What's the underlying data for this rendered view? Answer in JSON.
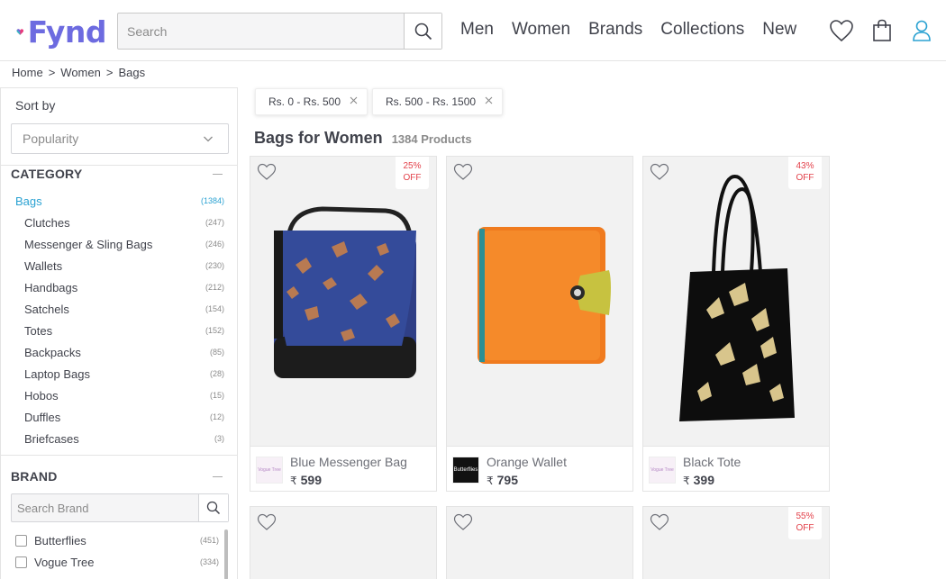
{
  "header": {
    "logo_text": "Fynd",
    "search_placeholder": "Search",
    "nav": [
      "Men",
      "Women",
      "Brands",
      "Collections",
      "New"
    ],
    "icons": [
      "heart-icon",
      "shopping-bag-icon",
      "user-icon"
    ]
  },
  "breadcrumb": [
    "Home",
    "Women",
    "Bags"
  ],
  "breadcrumb_sep": ">",
  "sidebar": {
    "sort_label": "Sort by",
    "sort_value": "Popularity",
    "category_title": "CATEGORY",
    "categories": [
      {
        "label": "Bags",
        "count": "(1384)",
        "active": true
      },
      {
        "label": "Clutches",
        "count": "(247)"
      },
      {
        "label": "Messenger & Sling Bags",
        "count": "(246)"
      },
      {
        "label": "Wallets",
        "count": "(230)"
      },
      {
        "label": "Handbags",
        "count": "(212)"
      },
      {
        "label": "Satchels",
        "count": "(154)"
      },
      {
        "label": "Totes",
        "count": "(152)"
      },
      {
        "label": "Backpacks",
        "count": "(85)"
      },
      {
        "label": "Laptop Bags",
        "count": "(28)"
      },
      {
        "label": "Hobos",
        "count": "(15)"
      },
      {
        "label": "Duffles",
        "count": "(12)"
      },
      {
        "label": "Briefcases",
        "count": "(3)"
      }
    ],
    "brand_title": "BRAND",
    "brand_search_placeholder": "Search Brand",
    "brands": [
      {
        "label": "Butterflies",
        "count": "(451)"
      },
      {
        "label": "Vogue Tree",
        "count": "(334)"
      }
    ]
  },
  "filters": [
    {
      "label": "Rs. 0 - Rs. 500"
    },
    {
      "label": "Rs. 500 - Rs. 1500"
    }
  ],
  "listing": {
    "title": "Bags for Women",
    "count": "1384 Products"
  },
  "currency": "₹",
  "products": [
    {
      "name": "Blue Messenger Bag",
      "price": "599",
      "discount_pct": "25%",
      "discount_word": "OFF",
      "brand_logo_text": "Vogue Tree"
    },
    {
      "name": "Orange Wallet",
      "price": "795",
      "brand_logo_text": "Butterflies"
    },
    {
      "name": "Black Tote",
      "price": "399",
      "discount_pct": "43%",
      "discount_word": "OFF",
      "brand_logo_text": "Vogue Tree"
    },
    {
      "discount_pct": "55%",
      "discount_word": "OFF"
    }
  ],
  "colors": {
    "accent": "#2ba2d2",
    "discount": "#e3424b",
    "brand_purple": "#6d6be0",
    "text": "#41434c"
  }
}
